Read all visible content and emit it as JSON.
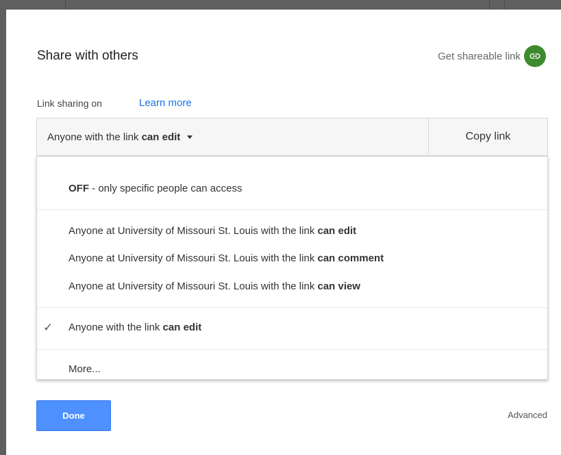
{
  "dialog": {
    "title": "Share with others",
    "shareable_link_label": "Get shareable link",
    "link_icon": "link-icon",
    "link_icon_color": "#3e8b2f"
  },
  "sharing": {
    "status": "Link sharing on",
    "learn_more": "Learn more"
  },
  "dropdown": {
    "selected_prefix": "Anyone with the link",
    "selected_bold": "can edit",
    "copy_link": "Copy link"
  },
  "menu": {
    "off_bold": "OFF",
    "off_rest": " - only specific people can access",
    "org_items": [
      {
        "prefix": "Anyone at University of Missouri St. Louis with the link ",
        "bold": "can edit"
      },
      {
        "prefix": "Anyone at University of Missouri St. Louis with the link ",
        "bold": "can comment"
      },
      {
        "prefix": "Anyone at University of Missouri St. Louis with the link ",
        "bold": "can view"
      }
    ],
    "checked_item": {
      "prefix": "Anyone with the link ",
      "bold": "can edit",
      "icon": "checkmark-icon"
    },
    "more": "More..."
  },
  "footer": {
    "done": "Done",
    "advanced": "Advanced",
    "done_color": "#4d90fe"
  }
}
